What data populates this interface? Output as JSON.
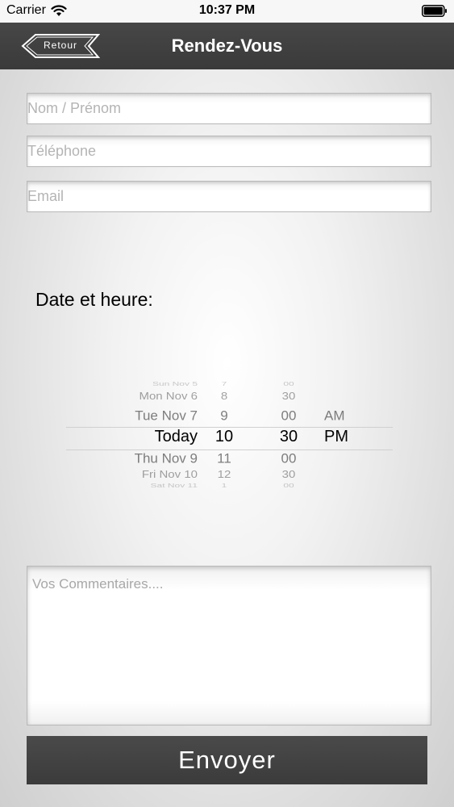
{
  "status_bar": {
    "carrier": "Carrier",
    "time": "10:37 PM"
  },
  "nav": {
    "back_label": "Retour",
    "title": "Rendez-Vous"
  },
  "form": {
    "name_placeholder": "Nom / Prénom",
    "phone_placeholder": "Téléphone",
    "email_placeholder": "Email",
    "date_label": "Date et heure:",
    "comments_placeholder": "Vos Commentaires....",
    "submit_label": "Envoyer"
  },
  "picker": {
    "rows": [
      {
        "day": "Sun Nov 5",
        "hour": "7",
        "minute": "00",
        "ampm": ""
      },
      {
        "day": "Mon Nov 6",
        "hour": "8",
        "minute": "30",
        "ampm": ""
      },
      {
        "day": "Tue Nov 7",
        "hour": "9",
        "minute": "00",
        "ampm": "AM"
      },
      {
        "day": "Today",
        "hour": "10",
        "minute": "30",
        "ampm": "PM"
      },
      {
        "day": "Thu Nov 9",
        "hour": "11",
        "minute": "00",
        "ampm": ""
      },
      {
        "day": "Fri Nov 10",
        "hour": "12",
        "minute": "30",
        "ampm": ""
      },
      {
        "day": "Sat Nov 11",
        "hour": "1",
        "minute": "00",
        "ampm": ""
      }
    ],
    "selected_index": 3
  },
  "icons": {
    "wifi": "wifi-icon",
    "battery": "battery-icon",
    "back": "back-arrow-icon"
  }
}
